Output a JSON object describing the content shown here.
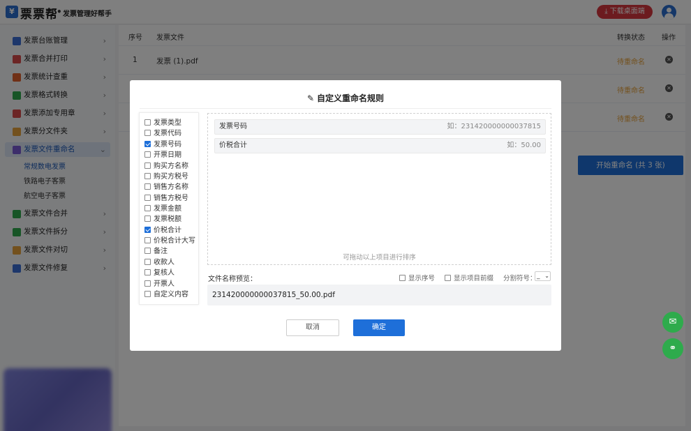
{
  "header": {
    "logo_glyph": "¥",
    "brand": "票票帮",
    "separator": "•",
    "slogan": "发票管理好帮手",
    "download_label": "下载桌面端",
    "download_icon": "download-icon",
    "download_color": "#d9363e"
  },
  "sidebar": {
    "items": [
      {
        "label": "发票台账管理",
        "icon": "ledger-icon",
        "color": "#3b6fd6"
      },
      {
        "label": "发票合并打印",
        "icon": "print-icon",
        "color": "#d94a4a"
      },
      {
        "label": "发票统计查重",
        "icon": "stats-icon",
        "color": "#e0602c"
      },
      {
        "label": "发票格式转换",
        "icon": "convert-icon",
        "color": "#2eab4c"
      },
      {
        "label": "发票添加专用章",
        "icon": "stamp-icon",
        "color": "#d94a4a"
      },
      {
        "label": "发票分文件夹",
        "icon": "folder-icon",
        "color": "#e6a23c"
      },
      {
        "label": "发票文件重命名",
        "icon": "rename-icon",
        "color": "#7a5cd6"
      },
      {
        "label": "发票文件合并",
        "icon": "merge-icon",
        "color": "#2eab4c"
      },
      {
        "label": "发票文件拆分",
        "icon": "split-icon",
        "color": "#2eab4c"
      },
      {
        "label": "发票文件对切",
        "icon": "cut-icon",
        "color": "#e6a23c"
      },
      {
        "label": "发票文件修复",
        "icon": "repair-icon",
        "color": "#3b6fd6"
      }
    ],
    "sub_items": [
      "常规数电发票",
      "铁路电子客票",
      "航空电子客票"
    ]
  },
  "table": {
    "headers": {
      "index": "序号",
      "file": "发票文件",
      "status": "转换状态",
      "action": "操作"
    },
    "rows": [
      {
        "index": "1",
        "file": "发票 (1).pdf",
        "status": "待重命名"
      },
      {
        "index": "",
        "file": "",
        "status": "待重命名"
      },
      {
        "index": "",
        "file": "",
        "status": "待重命名"
      }
    ],
    "start_button": "开始重命名 (共 3 张)"
  },
  "modal": {
    "title": "自定义重命名规则",
    "fields": [
      {
        "label": "发票类型",
        "checked": false
      },
      {
        "label": "发票代码",
        "checked": false
      },
      {
        "label": "发票号码",
        "checked": true
      },
      {
        "label": "开票日期",
        "checked": false
      },
      {
        "label": "购买方名称",
        "checked": false
      },
      {
        "label": "购买方税号",
        "checked": false
      },
      {
        "label": "销售方名称",
        "checked": false
      },
      {
        "label": "销售方税号",
        "checked": false
      },
      {
        "label": "发票金额",
        "checked": false
      },
      {
        "label": "发票税额",
        "checked": false
      },
      {
        "label": "价税合计",
        "checked": true
      },
      {
        "label": "价税合计大写",
        "checked": false
      },
      {
        "label": "备注",
        "checked": false
      },
      {
        "label": "收款人",
        "checked": false
      },
      {
        "label": "复核人",
        "checked": false
      },
      {
        "label": "开票人",
        "checked": false
      },
      {
        "label": "自定义内容",
        "checked": false
      }
    ],
    "selected": [
      {
        "name": "发票号码",
        "example": "如：231420000000037815"
      },
      {
        "name": "价税合计",
        "example": "如：50.00"
      }
    ],
    "sort_hint": "可拖动以上项目进行排序",
    "preview_label": "文件名称预览：",
    "show_index": "显示序号",
    "show_prefix": "显示项目前缀",
    "separator_label": "分割符号：",
    "separator_value": "_",
    "preview_value": "231420000000037815_50.00.pdf",
    "cancel": "取消",
    "ok": "确定"
  },
  "colors": {
    "accent": "#1e6fd9",
    "pending": "#e6a23c",
    "float": "#2eab4c"
  }
}
